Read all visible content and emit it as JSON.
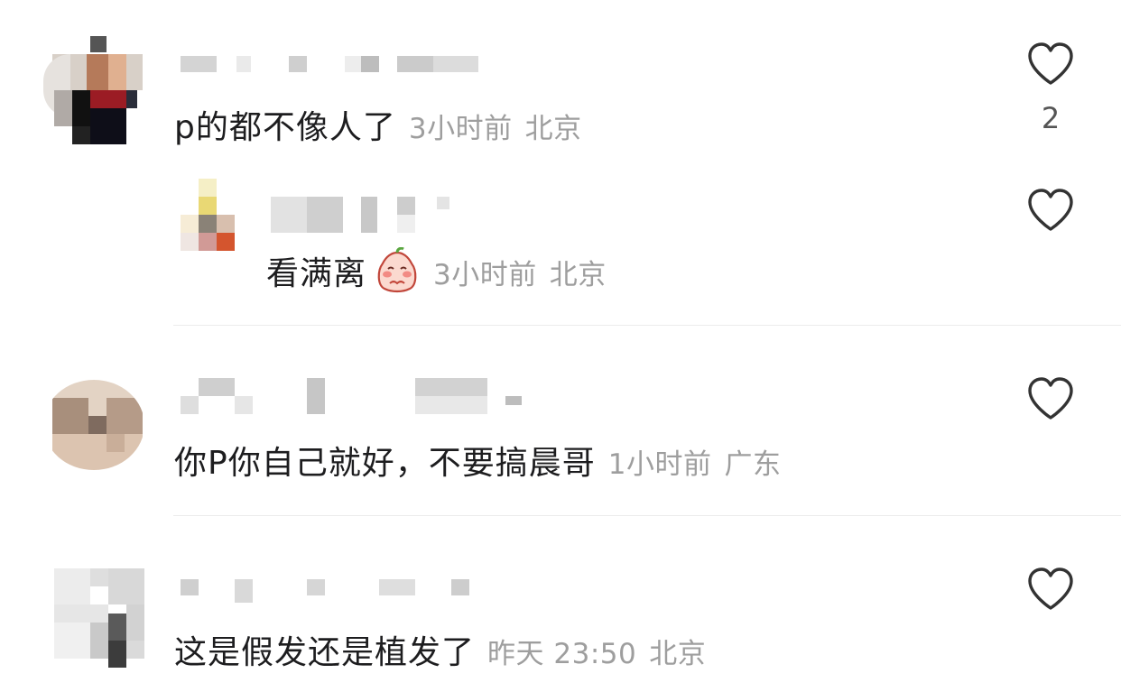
{
  "comments": [
    {
      "text": "p的都不像人了",
      "time": "3小时前",
      "location": "北京",
      "likes": "2",
      "replies": [
        {
          "text": "看满离",
          "emoji": "blushing-peach-emoji",
          "time": "3小时前",
          "location": "北京"
        }
      ]
    },
    {
      "text": "你P你自己就好，不要搞晨哥",
      "time": "1小时前",
      "location": "广东"
    },
    {
      "text": "这是假发还是植发了",
      "time": "昨天 23:50",
      "location": "北京"
    }
  ],
  "icons": {
    "like": "heart-outline-icon"
  },
  "colors": {
    "text": "#1d1d1f",
    "meta": "#9e9e9e",
    "icon": "#333333",
    "divider": "#ececec"
  }
}
